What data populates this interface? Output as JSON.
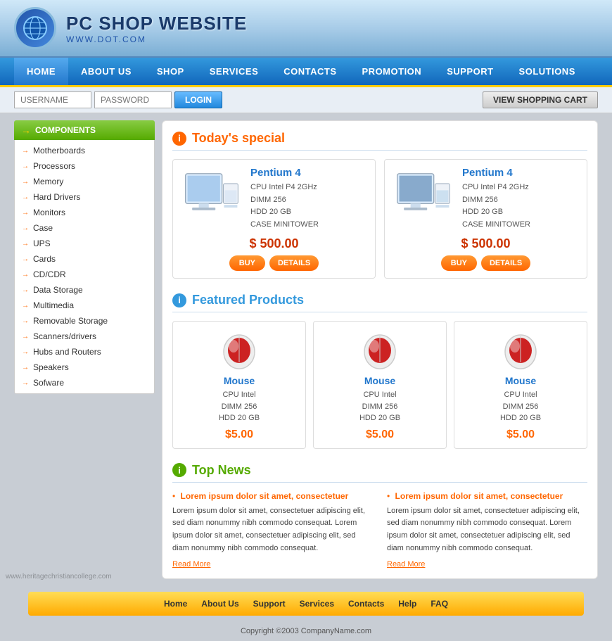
{
  "header": {
    "title": "PC SHOP WEBSITE",
    "url": "WWW.DOT.COM",
    "logo_alt": "globe-icon"
  },
  "nav": {
    "items": [
      {
        "label": "HOME",
        "active": true
      },
      {
        "label": "ABOUT US"
      },
      {
        "label": "SHOP"
      },
      {
        "label": "SERVICES"
      },
      {
        "label": "CONTACTS"
      },
      {
        "label": "PROMOTION"
      },
      {
        "label": "SUPPORT"
      },
      {
        "label": "SOLUTIONS"
      }
    ]
  },
  "login_bar": {
    "username_placeholder": "USERNAME",
    "password_placeholder": "PASSWORD",
    "login_label": "LOGIN",
    "cart_label": "VIEW SHOPPING CART"
  },
  "sidebar": {
    "header": "COMPONENTS",
    "items": [
      "Motherboards",
      "Processors",
      "Memory",
      "Hard Drivers",
      "Monitors",
      "Case",
      "UPS",
      "Cards",
      "CD/CDR",
      "Data Storage",
      "Multimedia",
      "Removable Storage",
      "Scanners/drivers",
      "Hubs and Routers",
      "Speakers",
      "Sofware"
    ]
  },
  "todays_special": {
    "title": "Today's special",
    "products": [
      {
        "name": "Pentium 4",
        "specs": [
          "CPU Intel P4 2GHz",
          "DIMM 256",
          "HDD 20 GB",
          "CASE MINITOWER"
        ],
        "price": "$ 500.00",
        "buy_label": "BUY",
        "details_label": "DETAILS"
      },
      {
        "name": "Pentium 4",
        "specs": [
          "CPU Intel P4 2GHz",
          "DIMM 256",
          "HDD 20 GB",
          "CASE MINITOWER"
        ],
        "price": "$ 500.00",
        "buy_label": "BUY",
        "details_label": "DETAILS"
      }
    ]
  },
  "featured_products": {
    "title": "Featured Products",
    "products": [
      {
        "name": "Mouse",
        "specs": [
          "CPU Intel",
          "DIMM 256",
          "HDD 20 GB"
        ],
        "price": "$5.00"
      },
      {
        "name": "Mouse",
        "specs": [
          "CPU Intel",
          "DIMM 256",
          "HDD 20 GB"
        ],
        "price": "$5.00"
      },
      {
        "name": "Mouse",
        "specs": [
          "CPU Intel",
          "DIMM 256",
          "HDD 20 GB"
        ],
        "price": "$5.00"
      }
    ]
  },
  "top_news": {
    "title": "Top News",
    "items": [
      {
        "headline": "Lorem ipsum dolor sit amet, consectetuer",
        "body": "Lorem ipsum dolor sit amet, consectetuer adipiscing elit, sed diam nonummy nibh commodo consequat. Lorem ipsum dolor sit amet, consectetuer adipiscing elit, sed diam nonummy nibh commodo consequat.",
        "read_more": "Read More"
      },
      {
        "headline": "Lorem ipsum dolor sit amet, consectetuer",
        "body": "Lorem ipsum dolor sit amet, consectetuer adipiscing elit, sed diam nonummy nibh commodo consequat. Lorem ipsum dolor sit amet, consectetuer adipiscing elit, sed diam nonummy nibh commodo consequat.",
        "read_more": "Read More"
      }
    ]
  },
  "footer_nav": {
    "links": [
      "Home",
      "About Us",
      "Support",
      "Services",
      "Contacts",
      "Help",
      "FAQ"
    ]
  },
  "footer": {
    "copyright": "Copyright ©2003 CompanyName.com"
  },
  "watermark": "www.heritagechristiancollege.com"
}
